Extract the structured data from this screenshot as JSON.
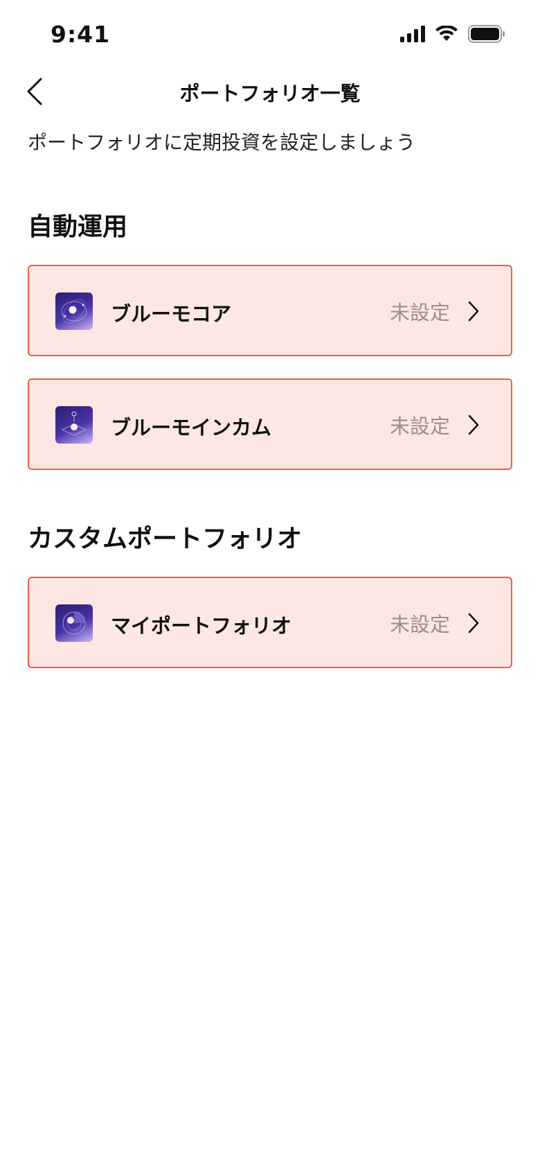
{
  "status_bar": {
    "time": "9:41"
  },
  "nav": {
    "title": "ポートフォリオ一覧"
  },
  "subtitle": "ポートフォリオに定期投資を設定しましょう",
  "sections": [
    {
      "title": "自動運用",
      "items": [
        {
          "label": "ブルーモコア",
          "status": "未設定"
        },
        {
          "label": "ブルーモインカム",
          "status": "未設定"
        }
      ]
    },
    {
      "title": "カスタムポートフォリオ",
      "items": [
        {
          "label": "マイポートフォリオ",
          "status": "未設定"
        }
      ]
    }
  ],
  "colors": {
    "card_background": "#fde7e3",
    "card_border": "#ee5d42",
    "status_text": "#9a8f8c",
    "icon_gradient_start": "#2d1d70",
    "icon_gradient_end": "#c6b8f7"
  }
}
